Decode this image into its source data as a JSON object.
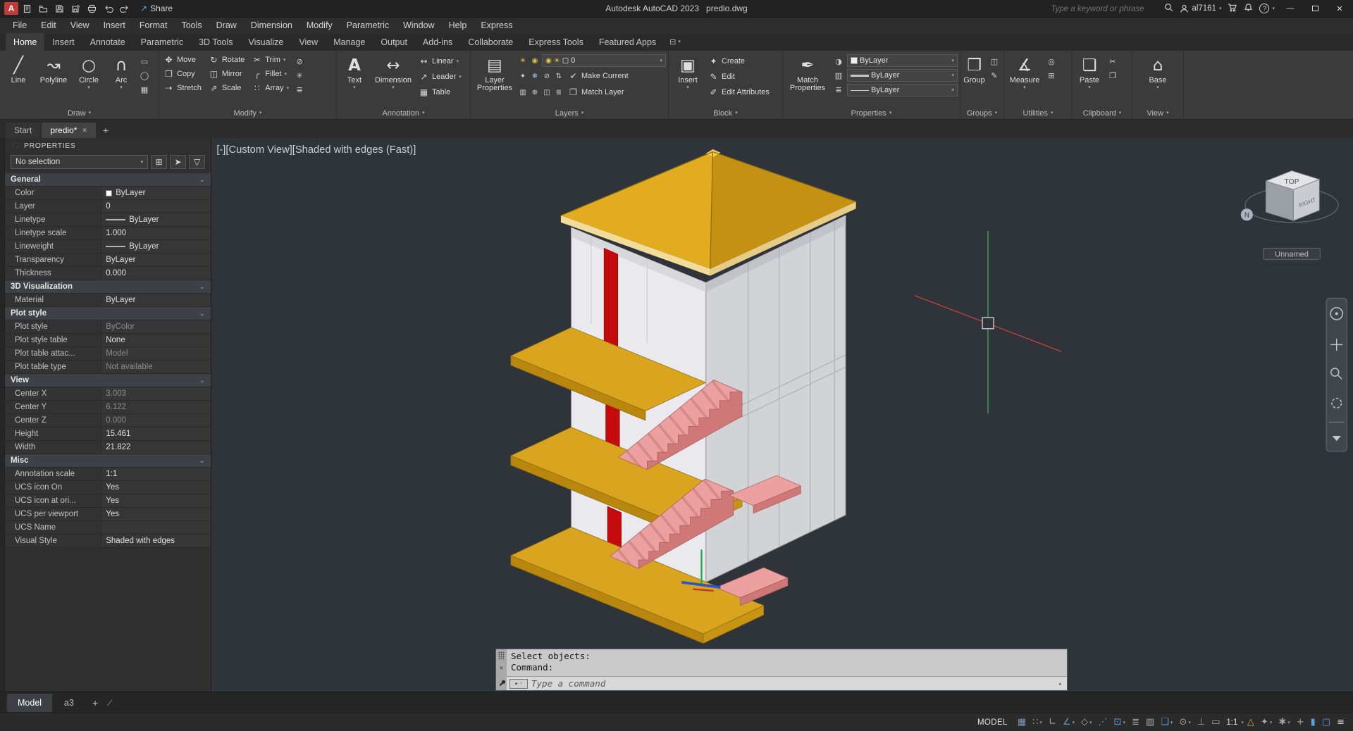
{
  "ui": {
    "caret": "▾",
    "chevron": "⌄",
    "close": "✕",
    "plus": "+",
    "minimize": "—",
    "collapse_arrow": "▴",
    "prompt_arrow": "▸",
    "slash": "∕",
    "help_glyph": "?",
    "share_arrow": "↗",
    "grip_dots": "⋮⋮"
  },
  "titlebar": {
    "app_button_label": "A",
    "quick_access_icons": [
      "new-file-icon",
      "open-file-icon",
      "save-icon",
      "save-as-icon",
      "plot-icon",
      "undo-icon",
      "redo-icon"
    ],
    "share_label": "Share",
    "title": "Autodesk AutoCAD 2023   predio.dwg",
    "search_placeholder": "Type a keyword or phrase",
    "username": "al7161"
  },
  "menubar": {
    "items": [
      "File",
      "Edit",
      "View",
      "Insert",
      "Format",
      "Tools",
      "Draw",
      "Dimension",
      "Modify",
      "Parametric",
      "Window",
      "Help",
      "Express"
    ]
  },
  "ribbon": {
    "tabs": [
      "Home",
      "Insert",
      "Annotate",
      "Parametric",
      "3D Tools",
      "Visualize",
      "View",
      "Manage",
      "Output",
      "Add-ins",
      "Collaborate",
      "Express Tools",
      "Featured Apps"
    ],
    "active_tab": "Home",
    "display_toggle_glyph": "⊟",
    "panels": {
      "draw": {
        "label": "Draw",
        "buttons": [
          {
            "glyph": "╱",
            "label": "Line"
          },
          {
            "glyph": "↝",
            "label": "Polyline"
          },
          {
            "glyph": "○",
            "label": "Circle"
          },
          {
            "glyph": "∩",
            "label": "Arc"
          }
        ],
        "mini": [
          "▭",
          "◯",
          "▦"
        ]
      },
      "modify": {
        "label": "Modify",
        "buttons": [
          {
            "glyph": "✥",
            "label": "Move"
          },
          {
            "glyph": "↻",
            "label": "Rotate"
          },
          {
            "glyph": "✂",
            "label": "Trim"
          },
          {
            "glyph": "❐",
            "label": "Copy"
          },
          {
            "glyph": "◫",
            "label": "Mirror"
          },
          {
            "glyph": "╭",
            "label": "Fillet"
          },
          {
            "glyph": "⇢",
            "label": "Stretch"
          },
          {
            "glyph": "⇗",
            "label": "Scale"
          },
          {
            "glyph": "∷",
            "label": "Array"
          }
        ],
        "mini": [
          "⊘",
          "✳",
          "≣"
        ]
      },
      "annotation": {
        "label": "Annotation",
        "text_button": {
          "glyph": "A",
          "label": "Text"
        },
        "dim_button": {
          "glyph": "↔",
          "label": "Dimension"
        },
        "buttons": [
          {
            "glyph": "↔",
            "label": "Linear"
          },
          {
            "glyph": "↗",
            "label": "Leader"
          },
          {
            "glyph": "▦",
            "label": "Table"
          }
        ]
      },
      "layers": {
        "label": "Layers",
        "big": {
          "glyph": "▤",
          "label": "Layer Properties"
        },
        "pre_icons": [
          "☀",
          "◉"
        ],
        "combo": {
          "icons": [
            "◉",
            "☀",
            "▢"
          ],
          "value": "0"
        },
        "strip2": [
          "✦",
          "❄",
          "⊘",
          "⇅"
        ],
        "strip3": [
          "▥",
          "⊕",
          "◫",
          "≣"
        ],
        "buttons": [
          {
            "glyph": "✔",
            "label": "Make Current"
          },
          {
            "glyph": "❐",
            "label": "Match Layer"
          }
        ]
      },
      "block": {
        "label": "Block",
        "big": {
          "glyph": "▣",
          "label": "Insert"
        },
        "buttons": [
          {
            "glyph": "✦",
            "label": "Create"
          },
          {
            "glyph": "✎",
            "label": "Edit"
          },
          {
            "glyph": "✐",
            "label": "Edit Attributes"
          }
        ]
      },
      "properties": {
        "label": "Properties",
        "big": {
          "glyph": "✒",
          "label": "Match Properties"
        },
        "mini": [
          "◑",
          "▥",
          "≣"
        ],
        "combos": [
          {
            "label": "ByLayer"
          },
          {
            "label": "ByLayer"
          },
          {
            "label": "ByLayer"
          }
        ]
      },
      "groups": {
        "label": "Groups",
        "big": {
          "glyph": "❒",
          "label": "Group"
        },
        "mini": [
          "◫",
          "✎"
        ]
      },
      "utilities": {
        "label": "Utilities",
        "big": {
          "glyph": "∡",
          "label": "Measure"
        },
        "mini": [
          "◎",
          "⊞"
        ]
      },
      "clipboard": {
        "label": "Clipboard",
        "big": {
          "glyph": "❏",
          "label": "Paste"
        },
        "mini": [
          "✂",
          "❐"
        ]
      },
      "view": {
        "label": "View",
        "big": {
          "glyph": "⌂",
          "label": "Base"
        }
      }
    }
  },
  "filetabs": {
    "start": "Start",
    "active": "predio*",
    "new": "+"
  },
  "palette": {
    "title": "PROPERTIES",
    "selector_value": "No selection",
    "selector_icons": [
      {
        "glyph": "⊞",
        "color": "#8fd0b0"
      },
      {
        "glyph": "➤",
        "color": "#d0d0d0"
      },
      {
        "glyph": "▽",
        "color": "#d8c050"
      }
    ],
    "sections": {
      "general": {
        "title": "General",
        "rows": [
          {
            "label": "Color",
            "value": "ByLayer"
          },
          {
            "label": "Layer",
            "value": "0"
          },
          {
            "label": "Linetype",
            "value": "ByLayer"
          },
          {
            "label": "Linetype scale",
            "value": "1.000"
          },
          {
            "label": "Lineweight",
            "value": "ByLayer"
          },
          {
            "label": "Transparency",
            "value": "ByLayer"
          },
          {
            "label": "Thickness",
            "value": "0.000"
          }
        ]
      },
      "vis3d": {
        "title": "3D Visualization",
        "rows": [
          {
            "label": "Material",
            "value": "ByLayer"
          }
        ]
      },
      "plot": {
        "title": "Plot style",
        "rows": [
          {
            "label": "Plot style",
            "value": "ByColor"
          },
          {
            "label": "Plot style table",
            "value": "None"
          },
          {
            "label": "Plot table attac...",
            "value": "Model"
          },
          {
            "label": "Plot table type",
            "value": "Not available"
          }
        ]
      },
      "view": {
        "title": "View",
        "rows": [
          {
            "label": "Center X",
            "value": "3.003"
          },
          {
            "label": "Center Y",
            "value": "6.122"
          },
          {
            "label": "Center Z",
            "value": "0.000"
          },
          {
            "label": "Height",
            "value": "15.461"
          },
          {
            "label": "Width",
            "value": "21.822"
          }
        ]
      },
      "misc": {
        "title": "Misc",
        "rows": [
          {
            "label": "Annotation scale",
            "value": "1:1"
          },
          {
            "label": "UCS icon On",
            "value": "Yes"
          },
          {
            "label": "UCS icon at ori...",
            "value": "Yes"
          },
          {
            "label": "UCS per viewport",
            "value": "Yes"
          },
          {
            "label": "UCS Name",
            "value": ""
          },
          {
            "label": "Visual Style",
            "value": "Shaded with edges"
          }
        ]
      }
    }
  },
  "viewport": {
    "label": "[-][Custom View][Shaded with edges (Fast)]",
    "viewcube": {
      "top": "TOP",
      "right": "RIGHT",
      "north": "N",
      "named_view": "Unnamed"
    }
  },
  "commandline": {
    "line1": "Select objects:",
    "line2": "Command:",
    "placeholder": "Type a command"
  },
  "layoutbar": {
    "model": "Model",
    "layout1": "a3",
    "new": "+"
  },
  "statusbar": {
    "model_label": "MODEL",
    "scale": "1:1",
    "accent_blue": "#5b9fd6",
    "icon_gray": "#a0a6ad",
    "icons": [
      {
        "name": "grid",
        "glyph": "▦",
        "style": "color:#7b98b4"
      },
      {
        "name": "snap",
        "glyph": "∷",
        "style": "color:#a0a6ad"
      },
      {
        "name": "ortho",
        "glyph": "∟",
        "style": "color:#a0a6ad"
      },
      {
        "name": "polar-tracking",
        "glyph": "∠",
        "style": "color:#5b9fd6"
      },
      {
        "name": "isodraft",
        "glyph": "◇",
        "style": "color:#a0a6ad"
      },
      {
        "name": "osnap-tracking",
        "glyph": "⋰",
        "style": "color:#5b9fd6"
      },
      {
        "name": "osnap",
        "glyph": "⊡",
        "style": "color:#5b9fd6"
      },
      {
        "name": "lineweight",
        "glyph": "≣",
        "style": "color:#a0a6ad"
      },
      {
        "name": "transparency",
        "glyph": "▨",
        "style": "color:#a0a6ad"
      },
      {
        "name": "selection-cycling",
        "glyph": "❏",
        "style": "color:#5b9fd6"
      },
      {
        "name": "osnap-3d",
        "glyph": "⊙",
        "style": "color:#a0a6ad"
      },
      {
        "name": "dynamic-ucs",
        "glyph": "⊥",
        "style": "color:#a0a6ad"
      },
      {
        "name": "dynamic-input",
        "glyph": "▭",
        "style": "color:#a0a6ad"
      },
      {
        "name": "annotation-visibility",
        "glyph": "△",
        "style": "color:#c9a94b"
      },
      {
        "name": "autoscale",
        "glyph": "✦",
        "style": "color:#a0a6ad"
      },
      {
        "name": "workspace",
        "glyph": "✱",
        "style": "color:#a0a6ad"
      },
      {
        "name": "annotation-monitor",
        "glyph": "+",
        "style": "color:#a0a6ad"
      },
      {
        "name": "graphics-performance",
        "glyph": "▮",
        "style": "color:#5b9fd6"
      },
      {
        "name": "clean-screen",
        "glyph": "▢",
        "style": "color:#5b9fd6"
      },
      {
        "name": "customize",
        "glyph": "≡",
        "style": "color:#cfcfcf"
      }
    ]
  },
  "scene": {
    "colors": {
      "roof_front": "#e3ac20",
      "roof_right": "#c49113",
      "roof_eave": "#f2dc9a",
      "roof_eave2": "#e6cc86",
      "roof_cap": "#f0cc55",
      "wall_left": "#eaeaee",
      "wall_right": "#d2d3d7",
      "wall_band": "#c2c3c9",
      "wall_shadow": "#d8d8dc",
      "slab_top": "#d9a41e",
      "slab_edge": "#b9860e",
      "slab_end": "#c79413",
      "stair_top": "#eda0a0",
      "stair_side": "#d07878",
      "red_strip": "#c40a0a",
      "axis_green": "#2ea84f",
      "axis_blue": "#2b55c8",
      "axis_red": "#c43a2a",
      "crosshair_green": "#35b558",
      "crosshair_red": "#d0453a"
    }
  }
}
